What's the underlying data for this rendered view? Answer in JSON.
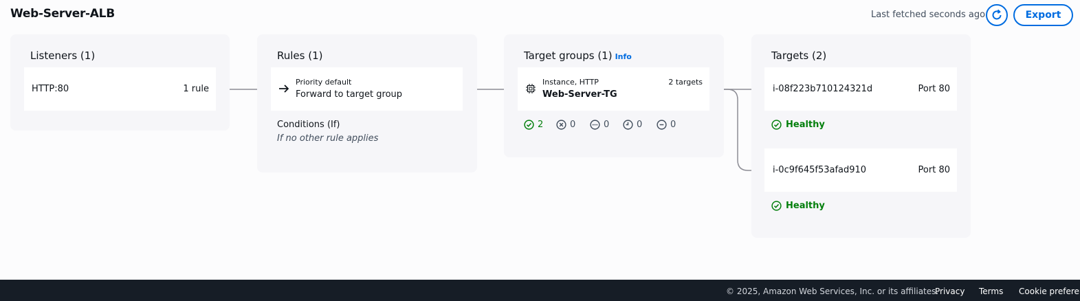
{
  "header": {
    "title": "Web-Server-ALB",
    "last_fetched": "Last fetched seconds ago",
    "refresh_icon": "refresh-icon",
    "export_label": "Export"
  },
  "listeners": {
    "title": "Listeners (1)",
    "item": {
      "protocol": "HTTP:80",
      "rules": "1 rule"
    }
  },
  "rules": {
    "title": "Rules (1)",
    "item": {
      "priority": "Priority default",
      "action": "Forward to target group",
      "icon": "arrow-right-icon"
    },
    "conditions_label": "Conditions (If)",
    "conditions_value": "If no other rule applies"
  },
  "target_groups": {
    "title": "Target groups (1)",
    "info": "Info",
    "item": {
      "type": "Instance, HTTP",
      "count": "2 targets",
      "name": "Web-Server-TG",
      "icon": "chip-icon"
    },
    "status": {
      "healthy": "2",
      "unhealthy": "0",
      "unused": "0",
      "initial": "0",
      "draining": "0"
    }
  },
  "targets": {
    "title": "Targets (2)",
    "items": [
      {
        "id": "i-08f223b710124321d",
        "port": "Port 80",
        "health": "Healthy"
      },
      {
        "id": "i-0c9f645f53afad910",
        "port": "Port 80",
        "health": "Healthy"
      }
    ]
  },
  "footer": {
    "copyright": "© 2025, Amazon Web Services, Inc. or its affiliates.",
    "privacy": "Privacy",
    "terms": "Terms",
    "cookies": "Cookie preferences"
  },
  "colors": {
    "accent": "#006ce0",
    "success": "#037f0c",
    "footer_bg": "#161d26"
  }
}
